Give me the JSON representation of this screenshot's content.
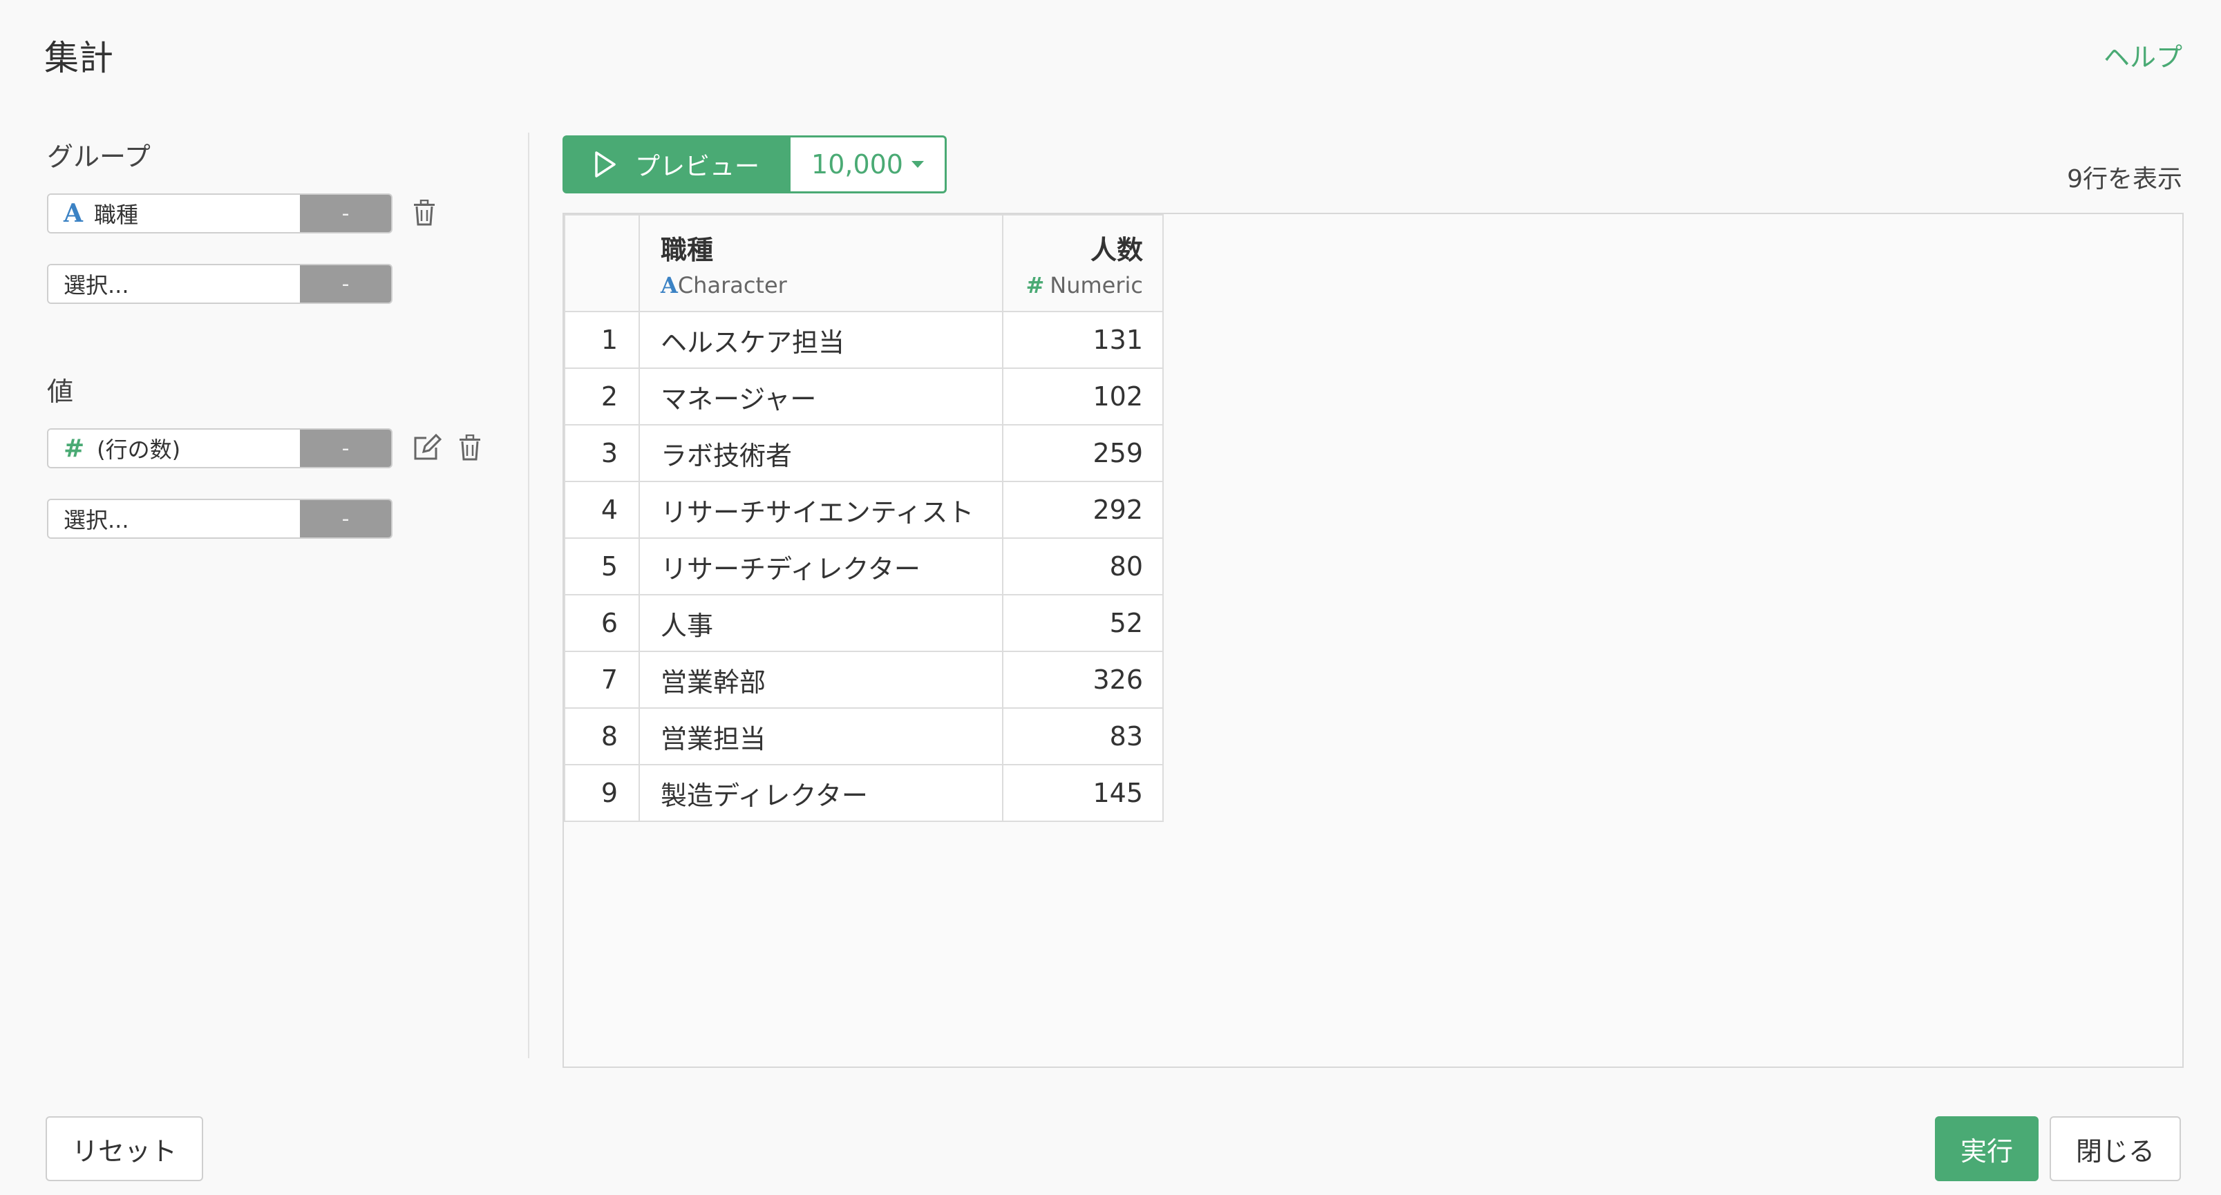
{
  "header": {
    "title": "集計",
    "help_label": "ヘルプ"
  },
  "group": {
    "label": "グループ",
    "fields": [
      {
        "type_icon": "A",
        "value": "職種",
        "drop_label": "-"
      },
      {
        "placeholder": "選択...",
        "drop_label": "-"
      }
    ]
  },
  "values": {
    "label": "値",
    "fields": [
      {
        "type_icon": "#",
        "value": "(行の数)",
        "drop_label": "-"
      },
      {
        "placeholder": "選択...",
        "drop_label": "-"
      }
    ]
  },
  "preview": {
    "button_label": "プレビュー",
    "rows_value": "10,000",
    "rows_shown": "9行を表示"
  },
  "table": {
    "columns": [
      {
        "name": "職種",
        "type_icon": "A",
        "type_label": "Character"
      },
      {
        "name": "人数",
        "type_icon": "#",
        "type_label": "Numeric"
      }
    ],
    "rows": [
      {
        "idx": "1",
        "job": "ヘルスケア担当",
        "count": "131"
      },
      {
        "idx": "2",
        "job": "マネージャー",
        "count": "102"
      },
      {
        "idx": "3",
        "job": "ラボ技術者",
        "count": "259"
      },
      {
        "idx": "4",
        "job": "リサーチサイエンティスト",
        "count": "292"
      },
      {
        "idx": "5",
        "job": "リサーチディレクター",
        "count": "80"
      },
      {
        "idx": "6",
        "job": "人事",
        "count": "52"
      },
      {
        "idx": "7",
        "job": "営業幹部",
        "count": "326"
      },
      {
        "idx": "8",
        "job": "営業担当",
        "count": "83"
      },
      {
        "idx": "9",
        "job": "製造ディレクター",
        "count": "145"
      }
    ]
  },
  "footer": {
    "reset_label": "リセット",
    "run_label": "実行",
    "close_label": "閉じる"
  },
  "colors": {
    "accent": "#4aaa74",
    "character_type": "#3b82c4",
    "dropdown_gray": "#9b9b9b"
  },
  "icons": {
    "delete": "trash-icon",
    "edit": "edit-icon",
    "play": "play-icon",
    "caret": "caret-down-icon"
  }
}
